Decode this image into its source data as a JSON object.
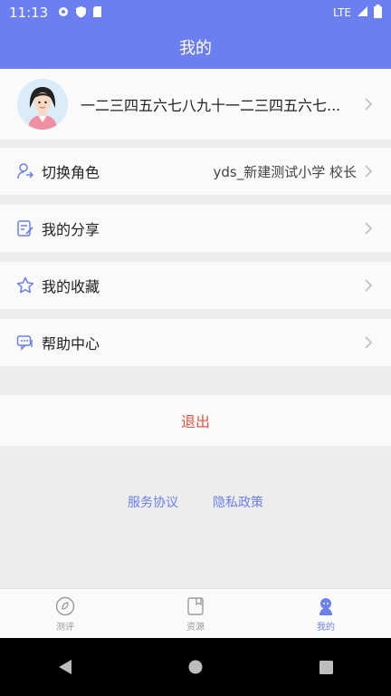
{
  "status_bar": {
    "time": "11:13",
    "network": "LTE"
  },
  "app_bar": {
    "title": "我的"
  },
  "profile": {
    "name": "一二三四五六七八九十一二三四五六七..."
  },
  "menu": [
    {
      "label": "切换角色",
      "value": "yds_新建测试小学 校长",
      "icon": "switch-user-icon"
    },
    {
      "label": "我的分享",
      "icon": "share-doc-icon"
    },
    {
      "label": "我的收藏",
      "icon": "star-icon"
    },
    {
      "label": "帮助中心",
      "icon": "help-chat-icon"
    }
  ],
  "logout_label": "退出",
  "links": {
    "service": "服务协议",
    "privacy": "隐私政策"
  },
  "tabs": [
    {
      "label": "测评",
      "icon": "evaluation-icon"
    },
    {
      "label": "资源",
      "icon": "resource-icon"
    },
    {
      "label": "我的",
      "icon": "mine-icon",
      "active": true
    }
  ],
  "colors": {
    "accent": "#6b7ff0",
    "logout": "#e6533e",
    "background": "#ededed"
  }
}
